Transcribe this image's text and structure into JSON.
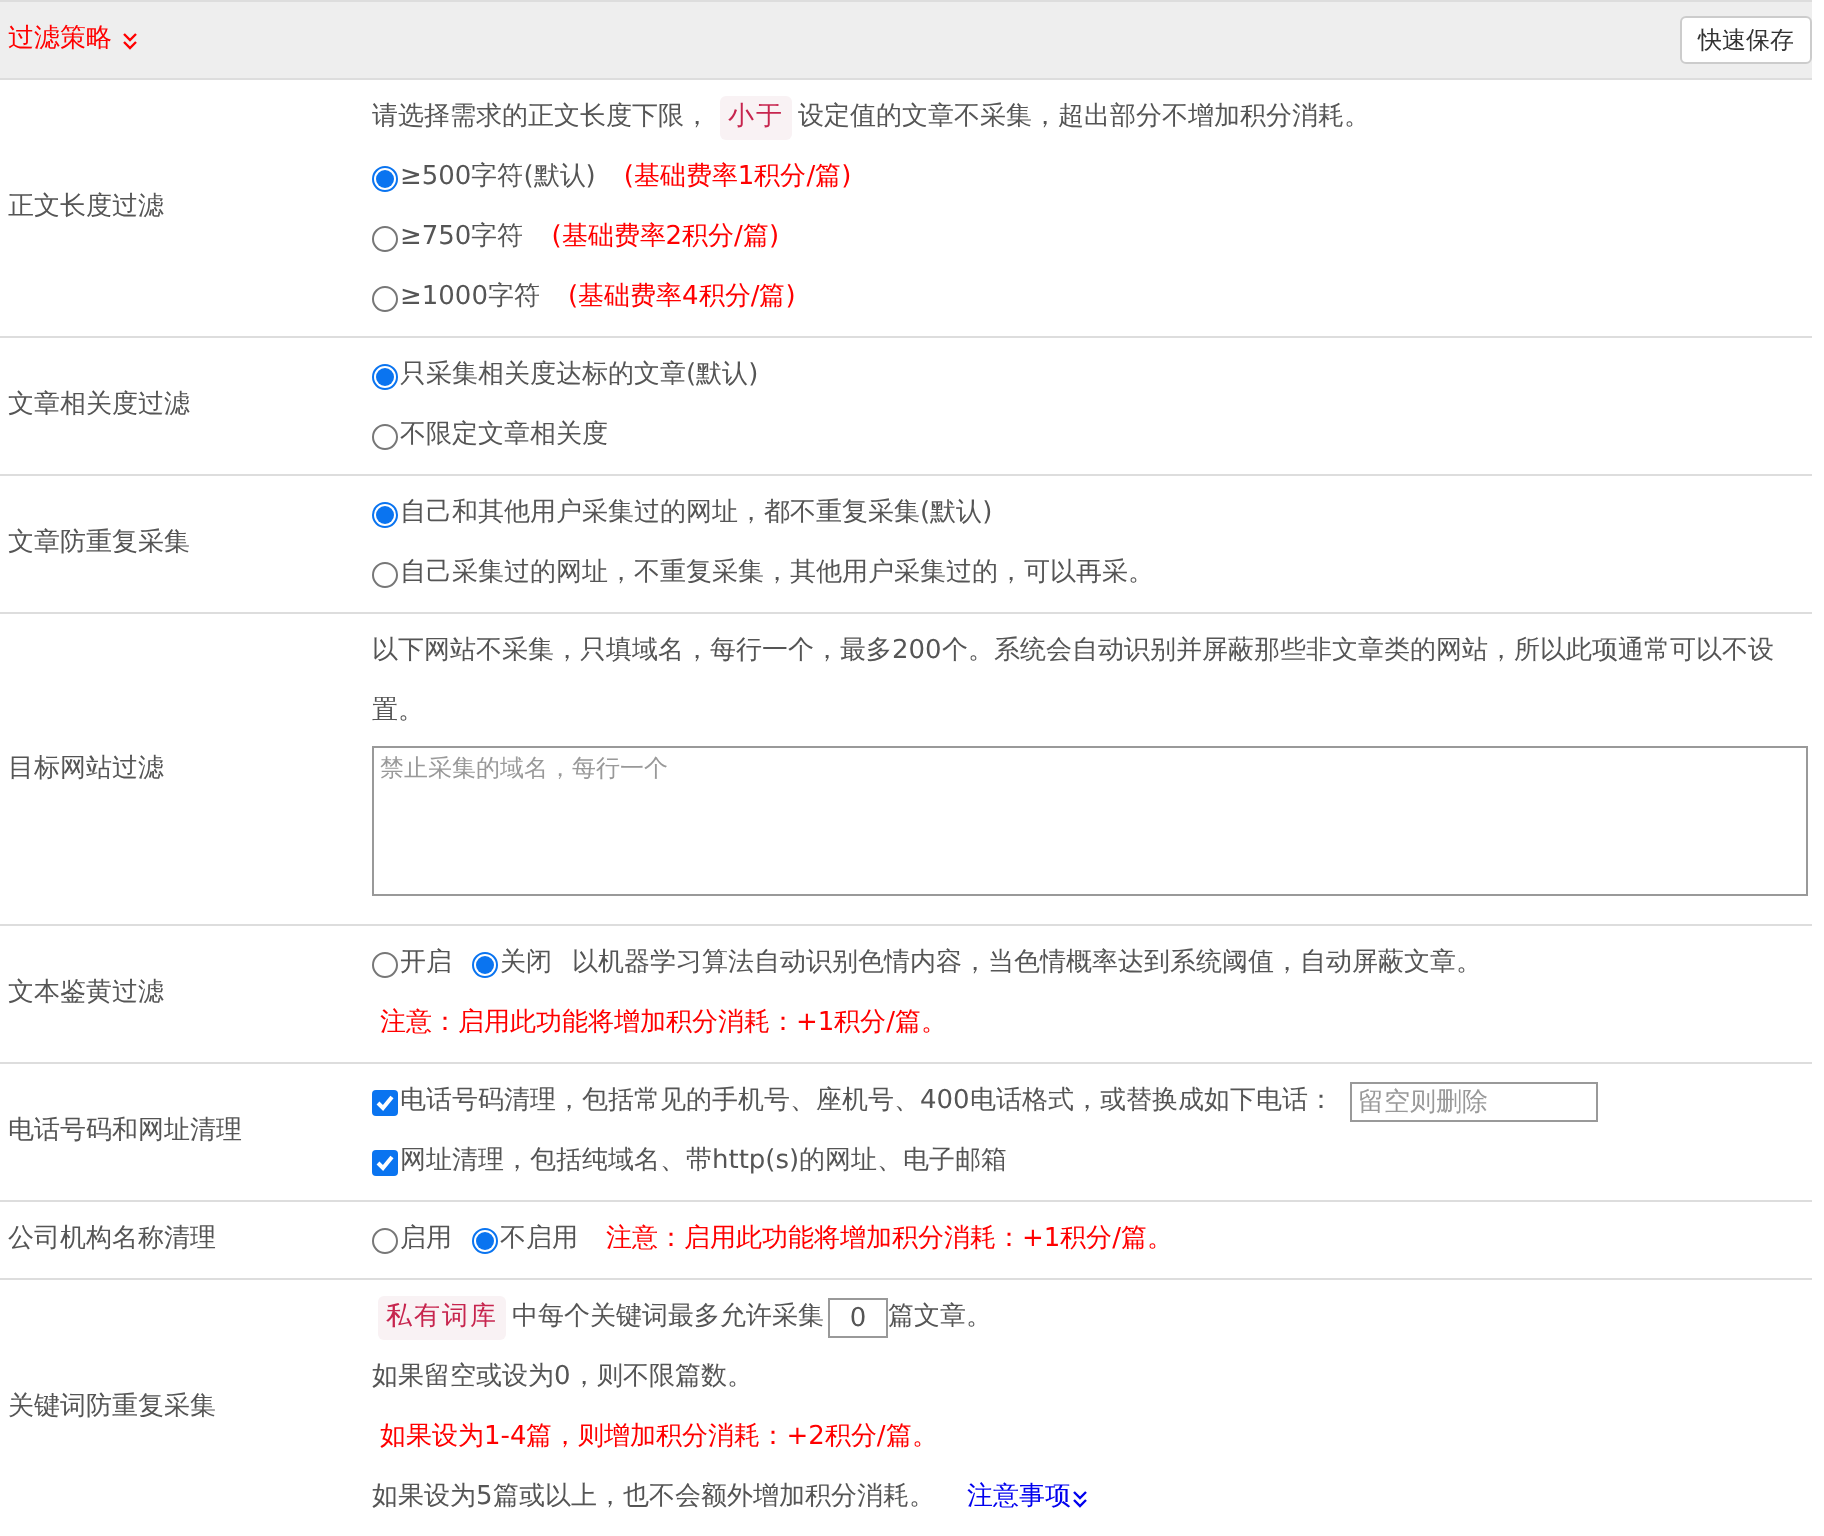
{
  "header": {
    "title": "过滤策略",
    "save_button": "快速保存"
  },
  "sections": [
    {
      "label": "正文长度过滤",
      "lines": [
        [
          {
            "kind": "text",
            "text": "请选择需求的正文长度下限，"
          },
          {
            "kind": "tag",
            "text": "小于"
          },
          {
            "kind": "text",
            "text": "设定值的文章不采集，超出部分不增加积分消耗。"
          }
        ],
        [
          {
            "kind": "radio",
            "text": "≥500字符(默认)",
            "selected": true
          },
          {
            "kind": "note",
            "text": "(基础费率1积分/篇)"
          }
        ],
        [
          {
            "kind": "radio",
            "text": "≥750字符",
            "selected": false
          },
          {
            "kind": "note",
            "text": "(基础费率2积分/篇)"
          }
        ],
        [
          {
            "kind": "radio",
            "text": "≥1000字符",
            "selected": false
          },
          {
            "kind": "note",
            "text": "(基础费率4积分/篇)"
          }
        ]
      ]
    },
    {
      "label": "文章相关度过滤",
      "lines": [
        [
          {
            "kind": "radio",
            "text": "只采集相关度达标的文章(默认)",
            "selected": true
          }
        ],
        [
          {
            "kind": "radio",
            "text": "不限定文章相关度",
            "selected": false
          }
        ]
      ]
    },
    {
      "label": "文章防重复采集",
      "lines": [
        [
          {
            "kind": "radio",
            "text": "自己和其他用户采集过的网址，都不重复采集(默认)",
            "selected": true
          }
        ],
        [
          {
            "kind": "radio",
            "text": "自己采集过的网址，不重复采集，其他用户采集过的，可以再采。",
            "selected": false
          }
        ]
      ]
    },
    {
      "label": "目标网站过滤",
      "lines": [
        [
          {
            "kind": "paragraph",
            "text": "以下网站不采集，只填域名，每行一个，最多200个。系统会自动识别并屏蔽那些非文章类的网站，所以此项通常可以不设置。"
          }
        ],
        [
          {
            "kind": "textarea",
            "placeholder": "禁止采集的域名，每行一个"
          }
        ]
      ]
    },
    {
      "label": "文本鉴黄过滤",
      "lines": [
        [
          {
            "kind": "radio",
            "text": "开启",
            "selected": false
          },
          {
            "kind": "radio",
            "text": "关闭",
            "selected": true
          },
          {
            "kind": "text",
            "text": "以机器学习算法自动识别色情内容，当色情概率达到系统阈值，自动屏蔽文章。"
          }
        ],
        [
          {
            "kind": "note",
            "text": "注意：启用此功能将增加积分消耗：+1积分/篇。"
          }
        ]
      ]
    },
    {
      "label": "电话号码和网址清理",
      "lines": [
        [
          {
            "kind": "checkbox",
            "text": "电话号码清理，包括常见的手机号、座机号、400电话格式，或替换成如下电话：",
            "checked": true
          },
          {
            "kind": "input",
            "placeholder": "留空则删除"
          }
        ],
        [
          {
            "kind": "checkbox",
            "text": "网址清理，包括纯域名、带http(s)的网址、电子邮箱",
            "checked": true
          }
        ]
      ]
    },
    {
      "label": "公司机构名称清理",
      "lines": [
        [
          {
            "kind": "radio",
            "text": "启用",
            "selected": false
          },
          {
            "kind": "radio",
            "text": "不启用",
            "selected": true
          },
          {
            "kind": "note",
            "text": "注意：启用此功能将增加积分消耗：+1积分/篇。"
          }
        ]
      ]
    },
    {
      "label": "关键词防重复采集",
      "lines": [
        [
          {
            "kind": "tag",
            "text": "私有词库"
          },
          {
            "kind": "text",
            "text": "中每个关键词最多允许采集"
          },
          {
            "kind": "number",
            "value": "0"
          },
          {
            "kind": "text",
            "text": "篇文章。"
          }
        ],
        [
          {
            "kind": "text",
            "text": "如果留空或设为0，则不限篇数。"
          }
        ],
        [
          {
            "kind": "note",
            "text": "如果设为1-4篇，则增加积分消耗：+2积分/篇。"
          }
        ],
        [
          {
            "kind": "text",
            "text": "如果设为5篇或以上，也不会额外增加积分消耗。"
          },
          {
            "kind": "link",
            "text": "注意事项"
          }
        ]
      ]
    }
  ]
}
